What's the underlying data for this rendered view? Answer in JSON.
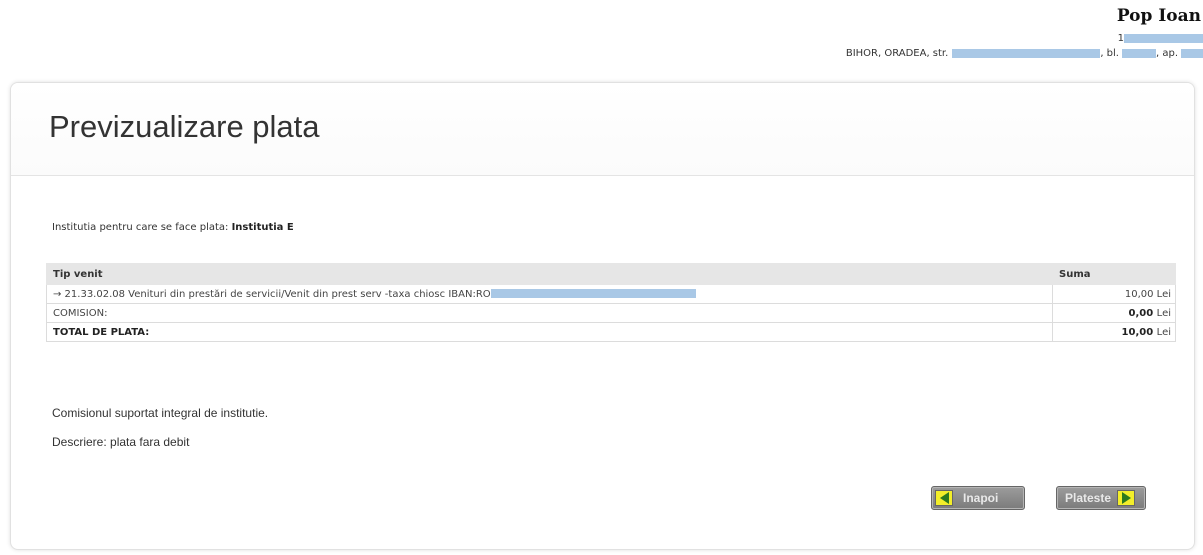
{
  "user": {
    "name": "Pop Ioan",
    "code_prefix": "1",
    "address_prefix": "BIHOR, ORADEA, str.",
    "address_bl": ", bl.",
    "address_ap": ", ap."
  },
  "page": {
    "title": "Previzualizare plata"
  },
  "institution": {
    "label": "Institutia pentru care se face plata:",
    "name": "Institutia E"
  },
  "table": {
    "headers": {
      "type": "Tip venit",
      "sum": "Suma"
    },
    "rows": [
      {
        "label": "→ 21.33.02.08 Venituri din prestări de servicii/Venit din prest serv -taxa chiosc IBAN:RO",
        "amount": "10,00",
        "unit": "Lei"
      },
      {
        "label": "COMISION:",
        "amount": "0,00",
        "unit": "Lei"
      },
      {
        "label": "TOTAL DE PLATA:",
        "amount": "10,00",
        "unit": "Lei"
      }
    ]
  },
  "notes": {
    "commission": "Comisionul suportat integral de institutie.",
    "description": "Descriere: plata fara debit"
  },
  "buttons": {
    "back": "Inapoi",
    "pay": "Plateste"
  },
  "colors": {
    "button_bg": "#8a8a8a",
    "arrow_box": "#f3ee2a",
    "arrow": "#2c7a1e",
    "redaction": "#a9c8e6"
  }
}
